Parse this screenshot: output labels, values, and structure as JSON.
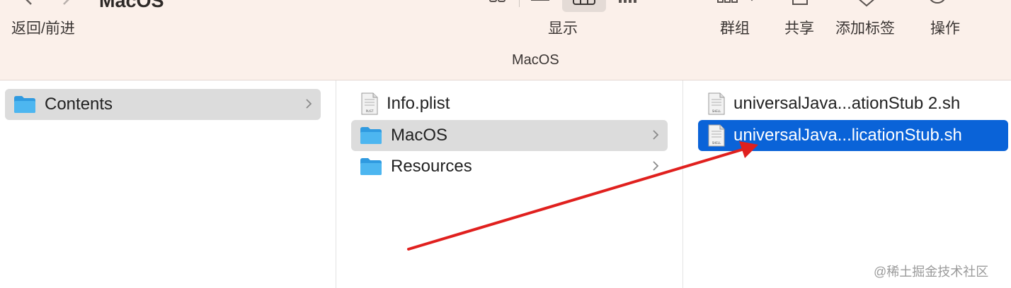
{
  "toolbar": {
    "title": "MacOS",
    "nav_label": "返回/前进",
    "view_label": "显示",
    "group_label": "群组",
    "share_label": "共享",
    "tags_label": "添加标签",
    "action_label": "操作",
    "path": "MacOS"
  },
  "columns": [
    {
      "items": [
        {
          "name": "Contents",
          "kind": "folder",
          "selected": "grey",
          "has_children": true
        }
      ]
    },
    {
      "items": [
        {
          "name": "Info.plist",
          "kind": "file",
          "badge": "PLIST"
        },
        {
          "name": "MacOS",
          "kind": "folder",
          "selected": "grey",
          "has_children": true
        },
        {
          "name": "Resources",
          "kind": "folder",
          "has_children": true
        }
      ]
    },
    {
      "items": [
        {
          "name": "universalJava...ationStub 2.sh",
          "kind": "file",
          "badge": "SHELL"
        },
        {
          "name": "universalJava...licationStub.sh",
          "kind": "file",
          "badge": "SHELL",
          "selected": "blue"
        }
      ]
    }
  ],
  "watermark": "@稀土掘金技术社区",
  "colors": {
    "toolbar_bg": "#fbf0ea",
    "selection_blue": "#0a63d8",
    "selection_grey": "#dcdcdc",
    "folder_blue": "#3aa7e8",
    "arrow_red": "#e0201e"
  }
}
